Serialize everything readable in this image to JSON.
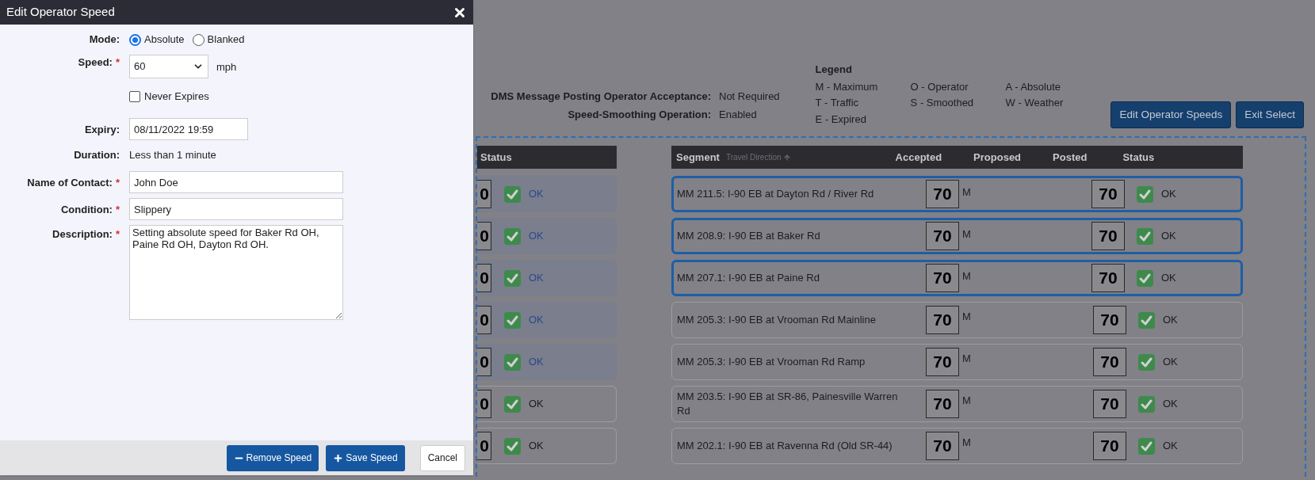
{
  "dialog": {
    "title": "Edit Operator Speed",
    "fields": [
      {
        "kind": "radio",
        "label": "Mode:",
        "options": [
          {
            "label": "Absolute",
            "selected": true
          },
          {
            "label": "Blanked",
            "selected": false
          }
        ]
      },
      {
        "kind": "select",
        "label": "Speed:",
        "mark": "*",
        "value": "60",
        "unit": "mph"
      },
      {
        "kind": "checkbox",
        "text": "Never Expires",
        "checked": false
      },
      {
        "kind": "text",
        "label": "Expiry:",
        "value": "08/11/2022 19:59"
      },
      {
        "kind": "static",
        "label": "Duration:",
        "value": "Less than 1 minute"
      },
      {
        "kind": "text",
        "label": "Name of Contact:",
        "mark": "*",
        "value": "John Doe"
      },
      {
        "kind": "text",
        "label": "Condition:",
        "mark": "*",
        "value": "Slippery"
      },
      {
        "kind": "textarea",
        "label": "Description:",
        "mark": "*",
        "value": "Setting absolute speed for Baker Rd OH, Paine Rd OH, Dayton Rd OH."
      }
    ],
    "buttons": [
      {
        "kind": "remove",
        "label": "Remove Speed"
      },
      {
        "kind": "save",
        "label": "Save Speed"
      },
      {
        "kind": "cancel",
        "label": "Cancel"
      }
    ]
  },
  "settings": [
    {
      "label": "DMS Message Posting Operator Acceptance:",
      "value": "Not Required"
    },
    {
      "label": "Speed-Smoothing Operation:",
      "value": "Enabled"
    }
  ],
  "legend": {
    "title": "Legend",
    "columns": [
      [
        "M - Maximum",
        "T - Traffic",
        "E - Expired"
      ],
      [
        "O - Operator",
        "S - Smoothed"
      ],
      [
        "A - Absolute",
        "W - Weather"
      ]
    ]
  },
  "actions": [
    "Edit Operator Speeds",
    "Exit Select"
  ],
  "left_table": {
    "columns": [
      "Status"
    ],
    "rows": [
      {
        "speed": "0",
        "status": "OK",
        "selected": true
      },
      {
        "speed": "0",
        "status": "OK",
        "selected": true
      },
      {
        "speed": "0",
        "status": "OK",
        "selected": true
      },
      {
        "speed": "0",
        "status": "OK",
        "selected": true
      },
      {
        "speed": "0",
        "status": "OK",
        "selected": true
      },
      {
        "speed": "0",
        "status": "OK",
        "selected": false
      },
      {
        "speed": "0",
        "status": "OK",
        "selected": false
      }
    ]
  },
  "right_table": {
    "columns": {
      "segment": "Segment",
      "sort": "Travel Direction",
      "accepted": "Accepted",
      "proposed": "Proposed",
      "posted": "Posted",
      "status": "Status"
    },
    "rows": [
      {
        "segment": "MM 211.5: I-90 EB at Dayton Rd / River Rd",
        "accepted": "70",
        "code": "M",
        "posted": "70",
        "status": "OK",
        "selected": true
      },
      {
        "segment": "MM 208.9: I-90 EB at Baker Rd",
        "accepted": "70",
        "code": "M",
        "posted": "70",
        "status": "OK",
        "selected": true
      },
      {
        "segment": "MM 207.1: I-90 EB at Paine Rd",
        "accepted": "70",
        "code": "M",
        "posted": "70",
        "status": "OK",
        "selected": true
      },
      {
        "segment": "MM 205.3: I-90 EB at Vrooman Rd Mainline",
        "accepted": "70",
        "code": "M",
        "posted": "70",
        "status": "OK",
        "selected": false
      },
      {
        "segment": "MM 205.3: I-90 EB at Vrooman Rd Ramp",
        "accepted": "70",
        "code": "M",
        "posted": "70",
        "status": "OK",
        "selected": false
      },
      {
        "segment": "MM 203.5: I-90 EB at SR-86, Painesville Warren Rd",
        "accepted": "70",
        "code": "M",
        "posted": "70",
        "status": "OK",
        "selected": false
      },
      {
        "segment": "MM 202.1: I-90 EB at Ravenna Rd (Old SR-44)",
        "accepted": "70",
        "code": "M",
        "posted": "70",
        "status": "OK",
        "selected": false
      }
    ]
  }
}
